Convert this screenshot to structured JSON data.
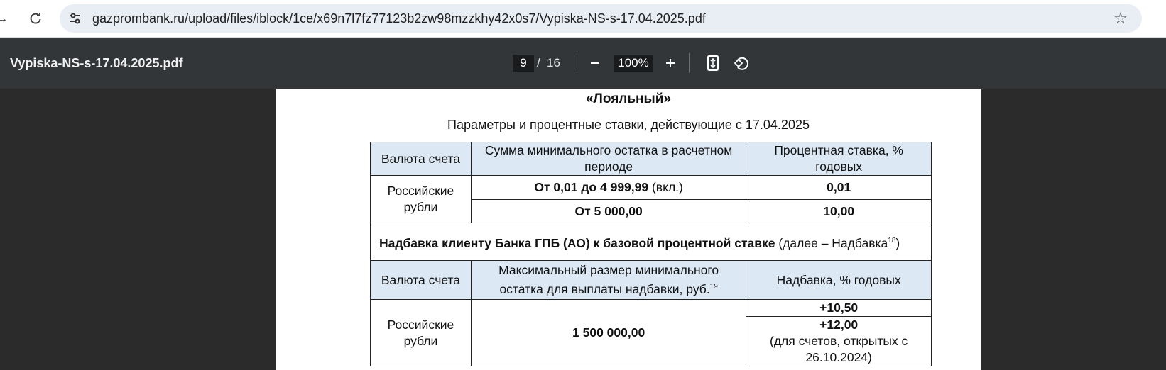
{
  "browser": {
    "url": "gazprombank.ru/upload/files/iblock/1ce/x69n7l7fz77123b2zw98mzzkhy42x0s7/Vypiska-NS-s-17.04.2025.pdf"
  },
  "pdf_toolbar": {
    "filename": "Vypiska-NS-s-17.04.2025.pdf",
    "current_page": "9",
    "page_separator": "/",
    "total_pages": "16",
    "zoom": "100%"
  },
  "document": {
    "title": "«Лояльный»",
    "subtitle": "Параметры и процентные ставки, действующие с 17.04.2025",
    "table1": {
      "headers": [
        "Валюта счета",
        "Сумма минимального остатка в расчетном периоде",
        "Процентная ставка, % годовых"
      ],
      "currency": "Российские рубли",
      "rows": [
        {
          "amount_bold": "От 0,01 до 4 999,99",
          "amount_note": " (вкл.)",
          "rate": "0,01"
        },
        {
          "amount_bold": "От 5 000,00",
          "amount_note": "",
          "rate": "10,00"
        }
      ]
    },
    "bonus": {
      "title_bold": "Надбавка клиенту Банка ГПБ (АО) к базовой процентной ставке",
      "title_rest": " (далее – Надбавка",
      "title_sup": "18",
      "title_close": ")"
    },
    "table2": {
      "headers": [
        "Валюта счета",
        "Максимальный размер минимального остатка для выплаты надбавки, руб.",
        "Надбавка, % годовых"
      ],
      "header_sup": "19",
      "currency": "Российские рубли",
      "max_balance": "1 500 000,00",
      "bonus_1": "+10,50",
      "bonus_2": "+12,00",
      "bonus_2_note": "(для счетов, открытых с 26.10.2024)"
    }
  }
}
